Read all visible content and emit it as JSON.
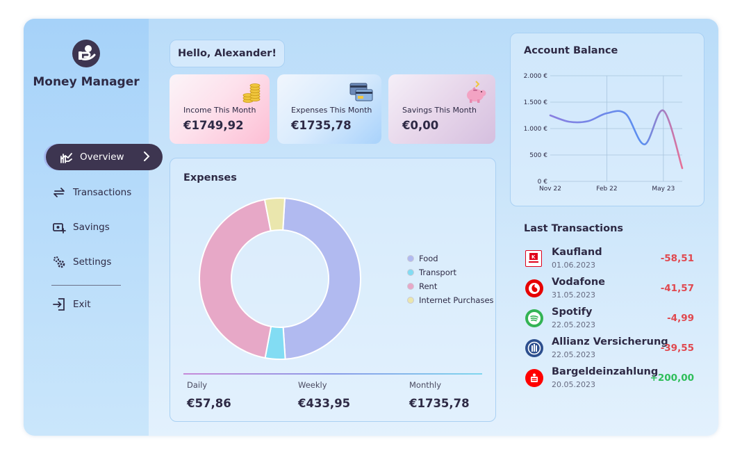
{
  "app": {
    "title": "Money Manager"
  },
  "sidebar": {
    "items": [
      {
        "label": "Overview",
        "icon": "chart-hand-icon",
        "active": true
      },
      {
        "label": "Transactions",
        "icon": "arrows-exchange-icon"
      },
      {
        "label": "Savings",
        "icon": "savings-icon"
      },
      {
        "label": "Settings",
        "icon": "gears-icon"
      },
      {
        "label": "Exit",
        "icon": "exit-icon"
      }
    ]
  },
  "greeting": "Hello, Alexander!",
  "stats": [
    {
      "label": "Income This Month",
      "value": "€1749,92",
      "icon": "coins-icon"
    },
    {
      "label": "Expenses This Month",
      "value": "€1735,78",
      "icon": "credit-cards-icon"
    },
    {
      "label": "Savings This Month",
      "value": "€0,00",
      "icon": "piggy-bank-icon"
    }
  ],
  "expenses": {
    "title": "Expenses",
    "legend": [
      "Food",
      "Transport",
      "Rent",
      "Internet Purchases"
    ],
    "periods": [
      {
        "label": "Daily",
        "value": "€57,86"
      },
      {
        "label": "Weekly",
        "value": "€433,95"
      },
      {
        "label": "Monthly",
        "value": "€1735,78"
      }
    ]
  },
  "balance": {
    "title": "Account Balance"
  },
  "chart_data": [
    {
      "type": "pie",
      "categories": [
        "Food",
        "Transport",
        "Rent",
        "Internet Purchases"
      ],
      "values": [
        48,
        4,
        44,
        4
      ],
      "colors": [
        "#b1baf0",
        "#82dcf3",
        "#e7a8c7",
        "#eae6ad"
      ],
      "donut": true
    },
    {
      "type": "line",
      "title": "Account Balance",
      "x": [
        "2022-11-01",
        "2022-12-01",
        "2023-01-01",
        "2023-02-01",
        "2023-03-01",
        "2023-04-01",
        "2023-05-01",
        "2023-06-01"
      ],
      "y": [
        1250,
        1130,
        1140,
        1290,
        1280,
        700,
        1340,
        250
      ],
      "xticks": [
        "Nov 22",
        "Feb 22",
        "May 23"
      ],
      "yticks": [
        "0 €",
        "500 €",
        "1.000 €",
        "1.500 €",
        "2.000 €"
      ],
      "ylim": [
        0,
        2000
      ],
      "grid": true,
      "colors": [
        "#6f7fe8",
        "#e86f96"
      ]
    }
  ],
  "transactions": {
    "title": "Last Transactions",
    "items": [
      {
        "name": "Kaufland",
        "date": "01.06.2023",
        "amount": "-58,51",
        "icon": "kaufland-logo-icon"
      },
      {
        "name": "Vodafone",
        "date": "31.05.2023",
        "amount": "-41,57",
        "icon": "vodafone-logo-icon"
      },
      {
        "name": "Spotify",
        "date": "22.05.2023",
        "amount": "-4,99",
        "icon": "spotify-logo-icon"
      },
      {
        "name": "Allianz Versicherung",
        "date": "22.05.2023",
        "amount": "-39,55",
        "icon": "allianz-logo-icon"
      },
      {
        "name": "Bargeldeinzahlung",
        "date": "20.05.2023",
        "amount": "+200,00",
        "icon": "sparkasse-logo-icon"
      }
    ],
    "negative_color": "#e0484f",
    "positive_color": "#2fbe5a"
  }
}
